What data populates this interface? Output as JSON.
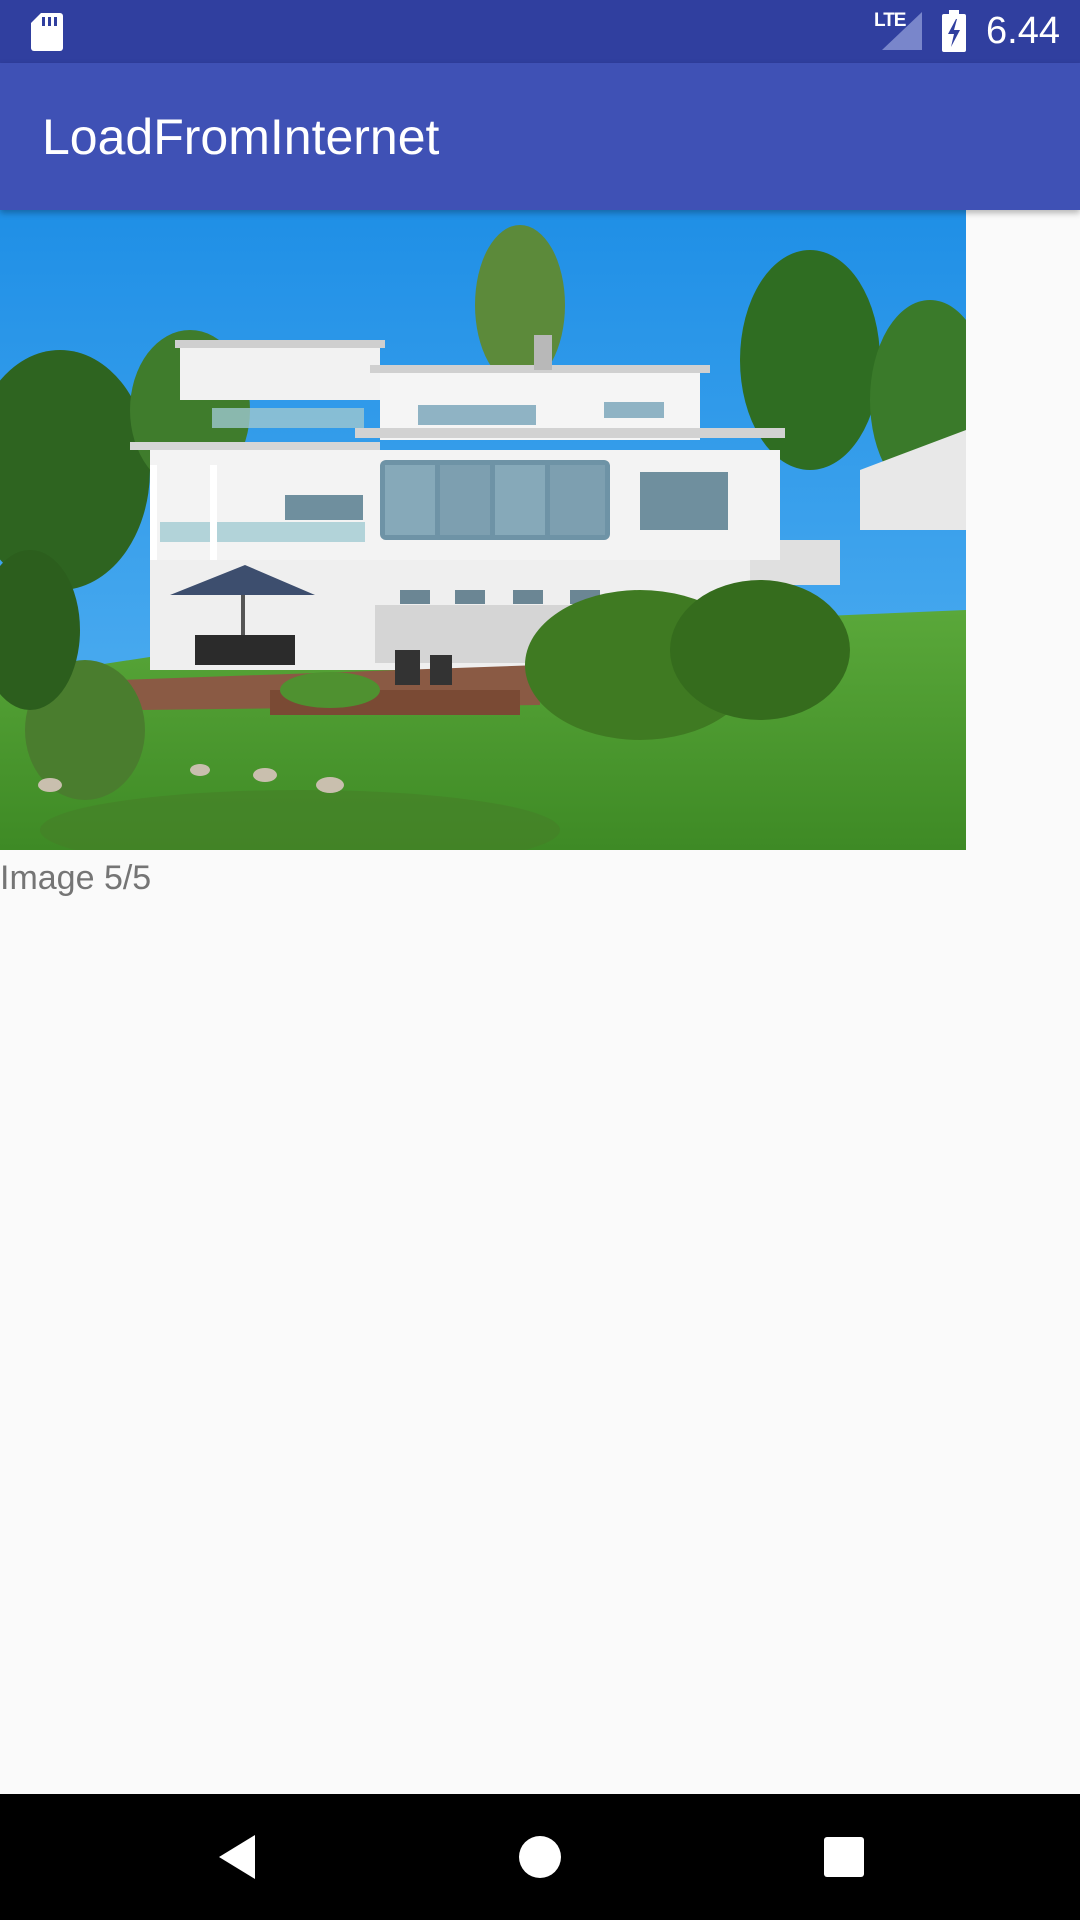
{
  "status_bar": {
    "network_label": "LTE",
    "time": "6.44",
    "icons": [
      "sd-card-icon",
      "signal-icon",
      "battery-charging-icon"
    ]
  },
  "app_bar": {
    "title": "LoadFromInternet"
  },
  "content": {
    "image_description": "house-photo",
    "caption": "Image 5/5"
  },
  "nav_bar": {
    "icons": [
      "back-icon",
      "home-icon",
      "recents-icon"
    ]
  },
  "colors": {
    "status_bar": "#303f9f",
    "app_bar": "#3f51b5",
    "background": "#fafafa",
    "caption_text": "#757575",
    "nav_bar": "#000000"
  }
}
